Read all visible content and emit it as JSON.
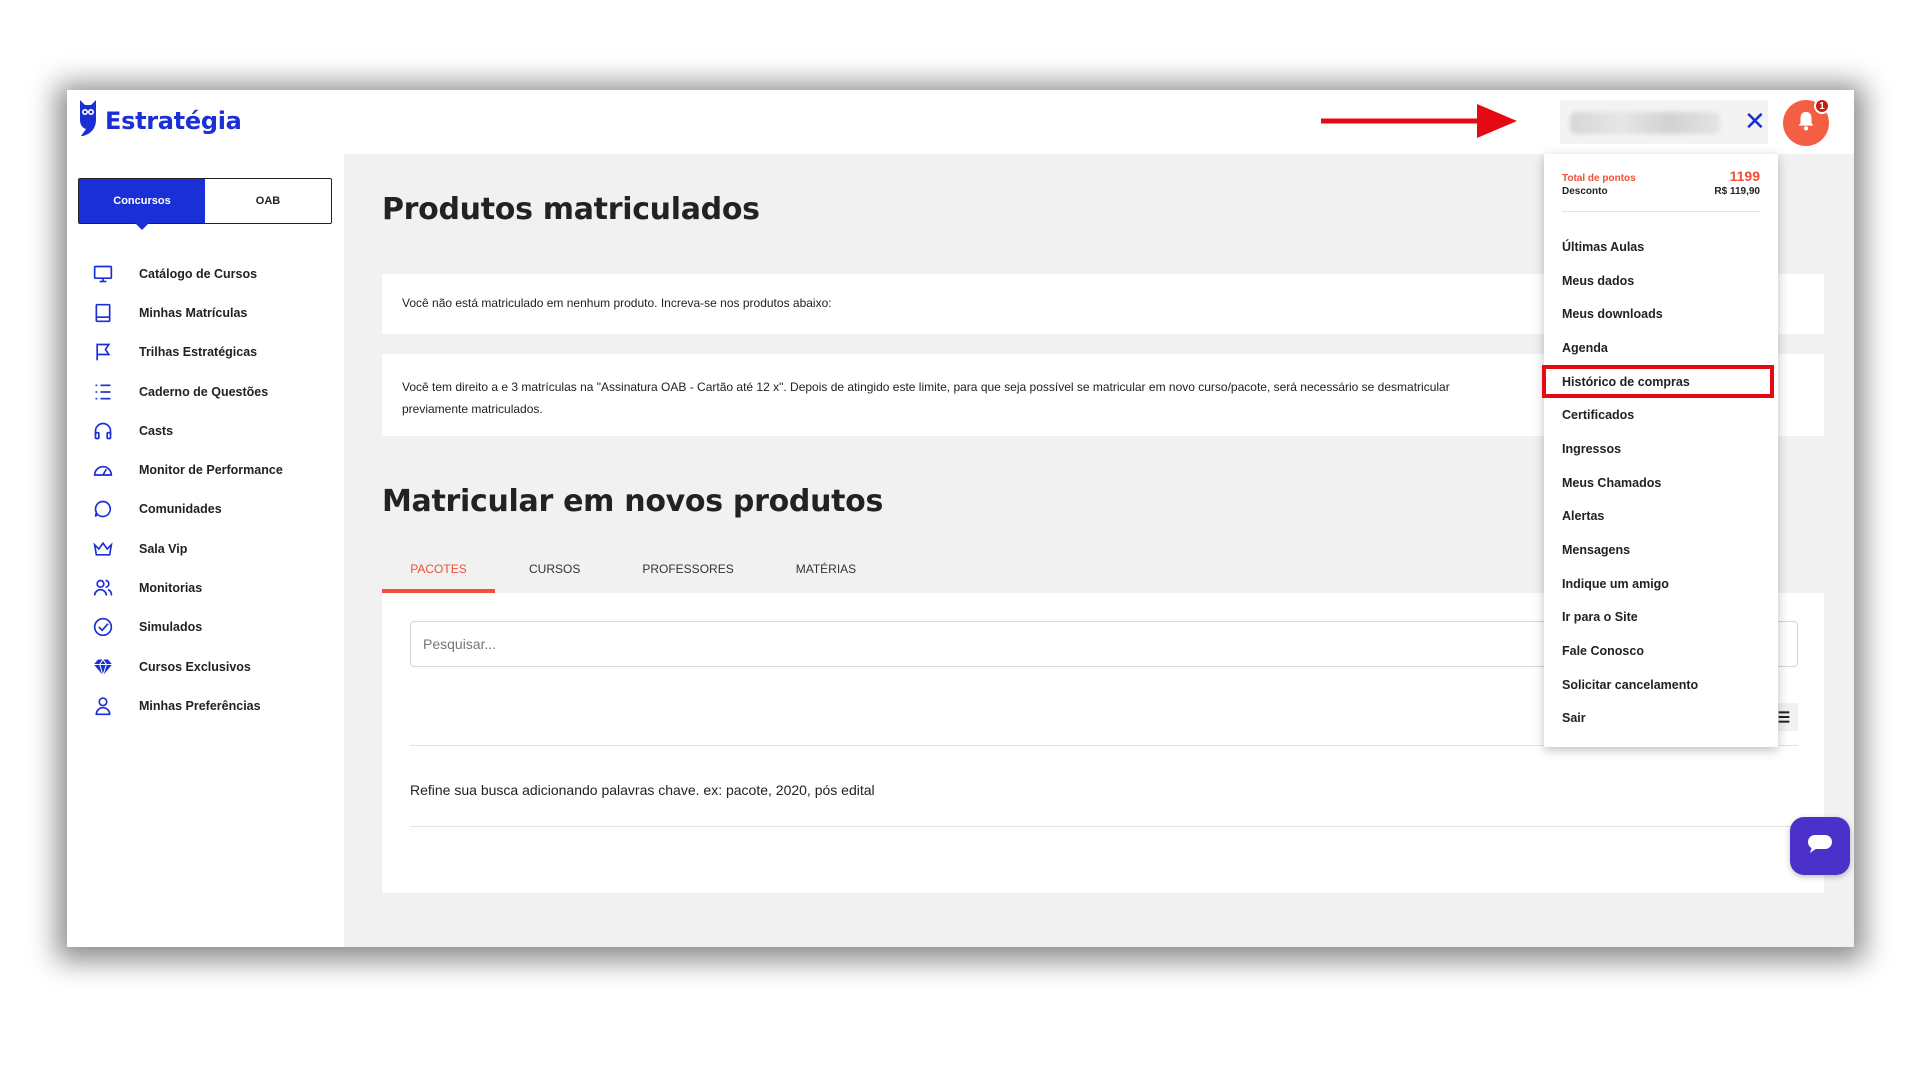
{
  "header": {
    "logo_text": "Estratégia",
    "notification_count": "1"
  },
  "sidebar": {
    "segments": [
      "Concursos",
      "OAB"
    ],
    "items": [
      {
        "label": "Catálogo de Cursos",
        "icon": "monitor-icon"
      },
      {
        "label": "Minhas Matrículas",
        "icon": "book-icon"
      },
      {
        "label": "Trilhas Estratégicas",
        "icon": "flag-icon"
      },
      {
        "label": "Caderno de Questões",
        "icon": "list-icon"
      },
      {
        "label": "Casts",
        "icon": "headphones-icon"
      },
      {
        "label": "Monitor de Performance",
        "icon": "gauge-icon"
      },
      {
        "label": "Comunidades",
        "icon": "chat-bubble-icon"
      },
      {
        "label": "Sala Vip",
        "icon": "crown-icon"
      },
      {
        "label": "Monitorias",
        "icon": "users-icon"
      },
      {
        "label": "Simulados",
        "icon": "check-circle-icon"
      },
      {
        "label": "Cursos Exclusivos",
        "icon": "diamond-icon"
      },
      {
        "label": "Minhas Preferências",
        "icon": "user-icon"
      }
    ]
  },
  "main": {
    "title": "Produtos matriculados",
    "notice_1": "Você não está matriculado em nenhum produto. Increva-se nos produtos abaixo:",
    "notice_2_line1": "Você tem direito a e 3 matrículas na \"Assinatura OAB - Cartão até 12 x\". Depois de atingido este limite, para que seja possível se matricular em novo curso/pacote, será necessário se desmatricular",
    "notice_2_line2": "previamente matriculados.",
    "section_title": "Matricular em novos produtos",
    "tabs": [
      "PACOTES",
      "CURSOS",
      "PROFESSORES",
      "MATÉRIAS"
    ],
    "search_placeholder": "Pesquisar...",
    "hint": "Refine sua busca adicionando palavras chave. ex: pacote, 2020, pós edital"
  },
  "dropdown": {
    "points_label": "Total de pontos",
    "points_value": "1199",
    "discount_label": "Desconto",
    "discount_value": "R$ 119,90",
    "items": [
      "Últimas Aulas",
      "Meus dados",
      "Meus downloads",
      "Agenda",
      "Histórico de compras",
      "Certificados",
      "Ingressos",
      "Meus Chamados",
      "Alertas",
      "Mensagens",
      "Indique um amigo",
      "Ir para o Site",
      "Fale Conosco",
      "Solicitar cancelamento",
      "Sair"
    ],
    "highlighted_index": 4
  },
  "colors": {
    "brand_blue": "#1b2fd6",
    "accent_orange": "#f24f37",
    "annotation_red": "#e50914",
    "chat_purple": "#4b31c9"
  }
}
